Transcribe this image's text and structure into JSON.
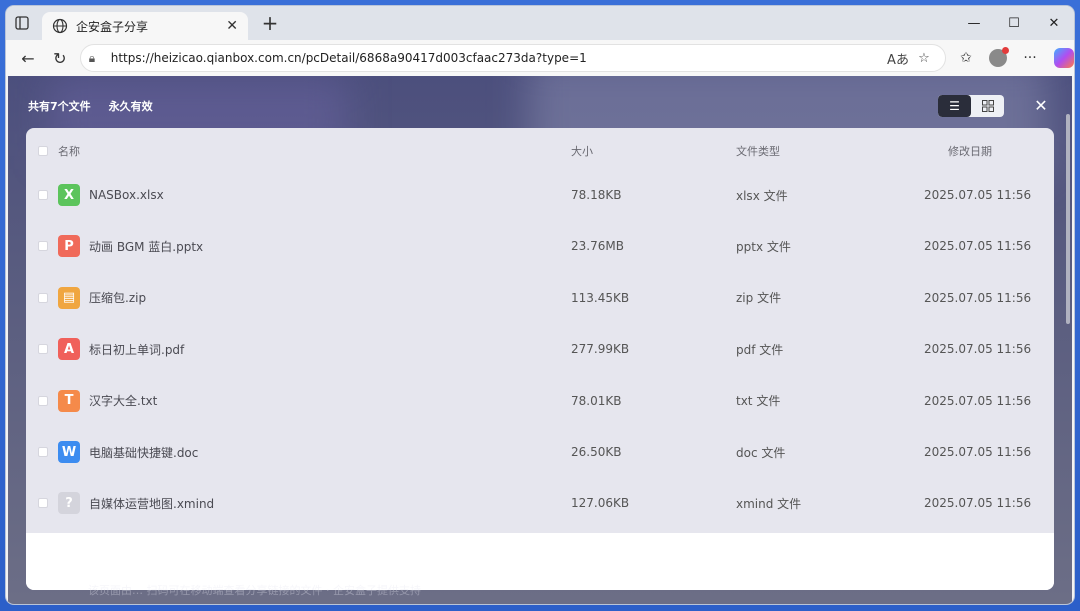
{
  "browser": {
    "tab_title": "企安盒子分享",
    "url": "https://heizicao.qianbox.com.cn/pcDetail/6868a90417d003cfaac273da?type=1"
  },
  "page": {
    "file_count_label": "共有7个文件",
    "validity_label": "永久有效",
    "bottom_note": "该页面由… 扫码可在移动端查看分享链接的文件 · 企安盒子提供支持"
  },
  "table": {
    "headers": {
      "name": "名称",
      "size": "大小",
      "type": "文件类型",
      "date": "修改日期"
    },
    "rows": [
      {
        "name": "NASBox.xlsx",
        "size": "78.18KB",
        "type": "xlsx 文件",
        "date": "2025.07.05 11:56",
        "icon": "excel-icon",
        "glyph": "X",
        "color": "#5cc45c"
      },
      {
        "name": "动画 BGM 蓝白.pptx",
        "size": "23.76MB",
        "type": "pptx 文件",
        "date": "2025.07.05 11:56",
        "icon": "powerpoint-icon",
        "glyph": "P",
        "color": "#f06a5a"
      },
      {
        "name": "压缩包.zip",
        "size": "113.45KB",
        "type": "zip 文件",
        "date": "2025.07.05 11:56",
        "icon": "zip-icon",
        "glyph": "▤",
        "color": "#f0a640"
      },
      {
        "name": "标日初上单词.pdf",
        "size": "277.99KB",
        "type": "pdf 文件",
        "date": "2025.07.05 11:56",
        "icon": "pdf-icon",
        "glyph": "A",
        "color": "#f0605a"
      },
      {
        "name": "汉字大全.txt",
        "size": "78.01KB",
        "type": "txt 文件",
        "date": "2025.07.05 11:56",
        "icon": "text-icon",
        "glyph": "T",
        "color": "#f58a4a"
      },
      {
        "name": "电脑基础快捷键.doc",
        "size": "26.50KB",
        "type": "doc 文件",
        "date": "2025.07.05 11:56",
        "icon": "word-icon",
        "glyph": "W",
        "color": "#3c8cf0"
      },
      {
        "name": "自媒体运营地图.xmind",
        "size": "127.06KB",
        "type": "xmind 文件",
        "date": "2025.07.05 11:56",
        "icon": "unknown-file-icon",
        "glyph": "?",
        "color": "#d4d4dc"
      }
    ]
  }
}
